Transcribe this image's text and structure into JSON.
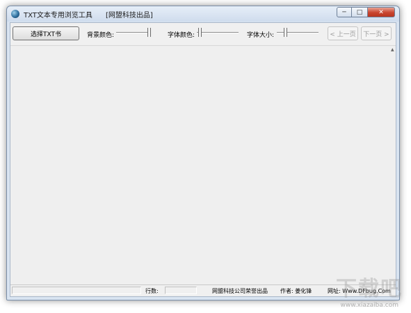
{
  "window": {
    "title": "TXT文本专用浏览工具",
    "subtitle": "[网盟科技出品]",
    "controls": {
      "minimize": "─",
      "maximize": "□",
      "close": "✕"
    }
  },
  "toolbar": {
    "select_button": "选择TXT书",
    "bg_color_label": "背景颜色:",
    "font_color_label": "字体颜色:",
    "font_size_label": "字体大小:",
    "prev_button": "< 上一页",
    "next_button": "下一页 >"
  },
  "statusbar": {
    "lines_label": "行数:",
    "lines_value": "",
    "company": "网盟科技公司荣誉出品",
    "author": "作者: 姜化锋",
    "website": "网址: Www.DFbug.Com"
  },
  "watermark": {
    "text": "下载吧",
    "url": "www.xiazaiba.com"
  }
}
